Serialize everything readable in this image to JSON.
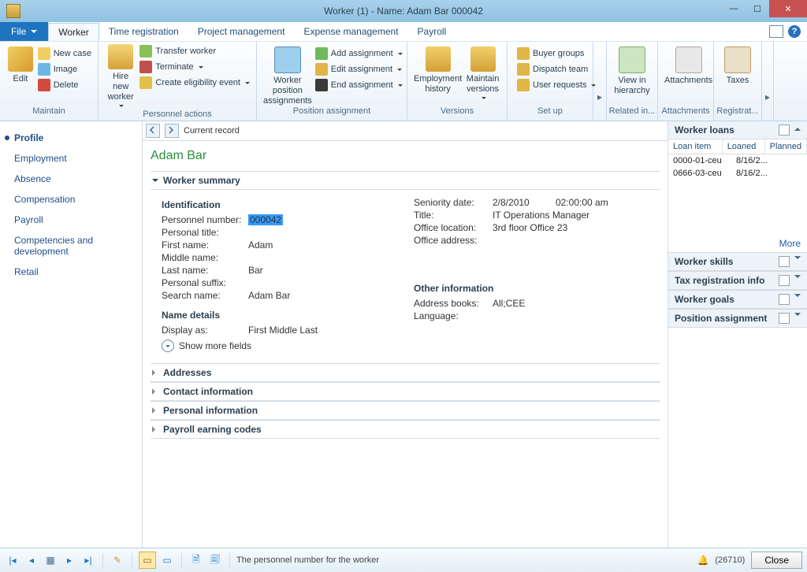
{
  "window": {
    "title": "Worker (1) - Name: Adam Bar   000042"
  },
  "menubar": {
    "file": "File",
    "tabs": [
      "Worker",
      "Time registration",
      "Project management",
      "Expense management",
      "Payroll"
    ],
    "active": 0
  },
  "ribbon": {
    "maintain": {
      "title": "Maintain",
      "edit": "Edit",
      "new_case": "New case",
      "image": "Image",
      "delete": "Delete"
    },
    "personnel": {
      "title": "Personnel actions",
      "hire": "Hire new worker",
      "transfer": "Transfer worker",
      "terminate": "Terminate",
      "eligibility": "Create eligibility event"
    },
    "position": {
      "title": "Position assignment",
      "assignments": "Worker position assignments",
      "add": "Add assignment",
      "edit": "Edit assignment",
      "end": "End assignment"
    },
    "versions": {
      "title": "Versions",
      "history": "Employment history",
      "maintain": "Maintain versions"
    },
    "setup": {
      "title": "Set up",
      "buyer": "Buyer groups",
      "dispatch": "Dispatch team",
      "user_req": "User requests"
    },
    "related": {
      "title": "Related in...",
      "view": "View in hierarchy"
    },
    "attachments": {
      "title": "Attachments",
      "label": "Attachments"
    },
    "registration": {
      "title": "Registrat...",
      "label": "Taxes"
    }
  },
  "leftnav": [
    "Profile",
    "Employment",
    "Absence",
    "Compensation",
    "Payroll",
    "Competencies and development",
    "Retail"
  ],
  "leftnav_active": 0,
  "current_record": "Current record",
  "worker_name": "Adam Bar",
  "summary": {
    "title": "Worker summary",
    "identification": {
      "title": "Identification",
      "personnel_number_lbl": "Personnel number:",
      "personnel_number": "000042",
      "personal_title_lbl": "Personal title:",
      "personal_title": "",
      "first_name_lbl": "First name:",
      "first_name": "Adam",
      "middle_name_lbl": "Middle name:",
      "middle_name": "",
      "last_name_lbl": "Last name:",
      "last_name": "Bar",
      "personal_suffix_lbl": "Personal suffix:",
      "personal_suffix": "",
      "search_name_lbl": "Search name:",
      "search_name": "Adam Bar"
    },
    "name_details": {
      "title": "Name details",
      "display_as_lbl": "Display as:",
      "display_as": "First Middle Last",
      "show_more": "Show more fields"
    },
    "right_col": {
      "seniority_lbl": "Seniority date:",
      "seniority_date": "2/8/2010",
      "seniority_time": "02:00:00 am",
      "title_lbl": "Title:",
      "title": "IT Operations Manager",
      "office_loc_lbl": "Office location:",
      "office_loc": "3rd floor Office 23",
      "office_addr_lbl": "Office address:",
      "office_addr": "",
      "other_title": "Other information",
      "address_books_lbl": "Address books:",
      "address_books": "All;CEE",
      "language_lbl": "Language:",
      "language": ""
    }
  },
  "sections": [
    "Addresses",
    "Contact information",
    "Personal information",
    "Payroll earning codes"
  ],
  "right": {
    "loans": {
      "title": "Worker loans",
      "cols": [
        "Loan item",
        "Loaned",
        "Planned"
      ],
      "rows": [
        {
          "item": "0000-01-ceu",
          "loaned": "8/16/2..."
        },
        {
          "item": "0666-03-ceu",
          "loaned": "8/16/2..."
        }
      ],
      "more": "More"
    },
    "sections": [
      "Worker skills",
      "Tax registration info",
      "Worker goals",
      "Position assignment"
    ]
  },
  "statusbar": {
    "hint": "The personnel number for the worker",
    "notif": "(26710)",
    "close": "Close"
  }
}
